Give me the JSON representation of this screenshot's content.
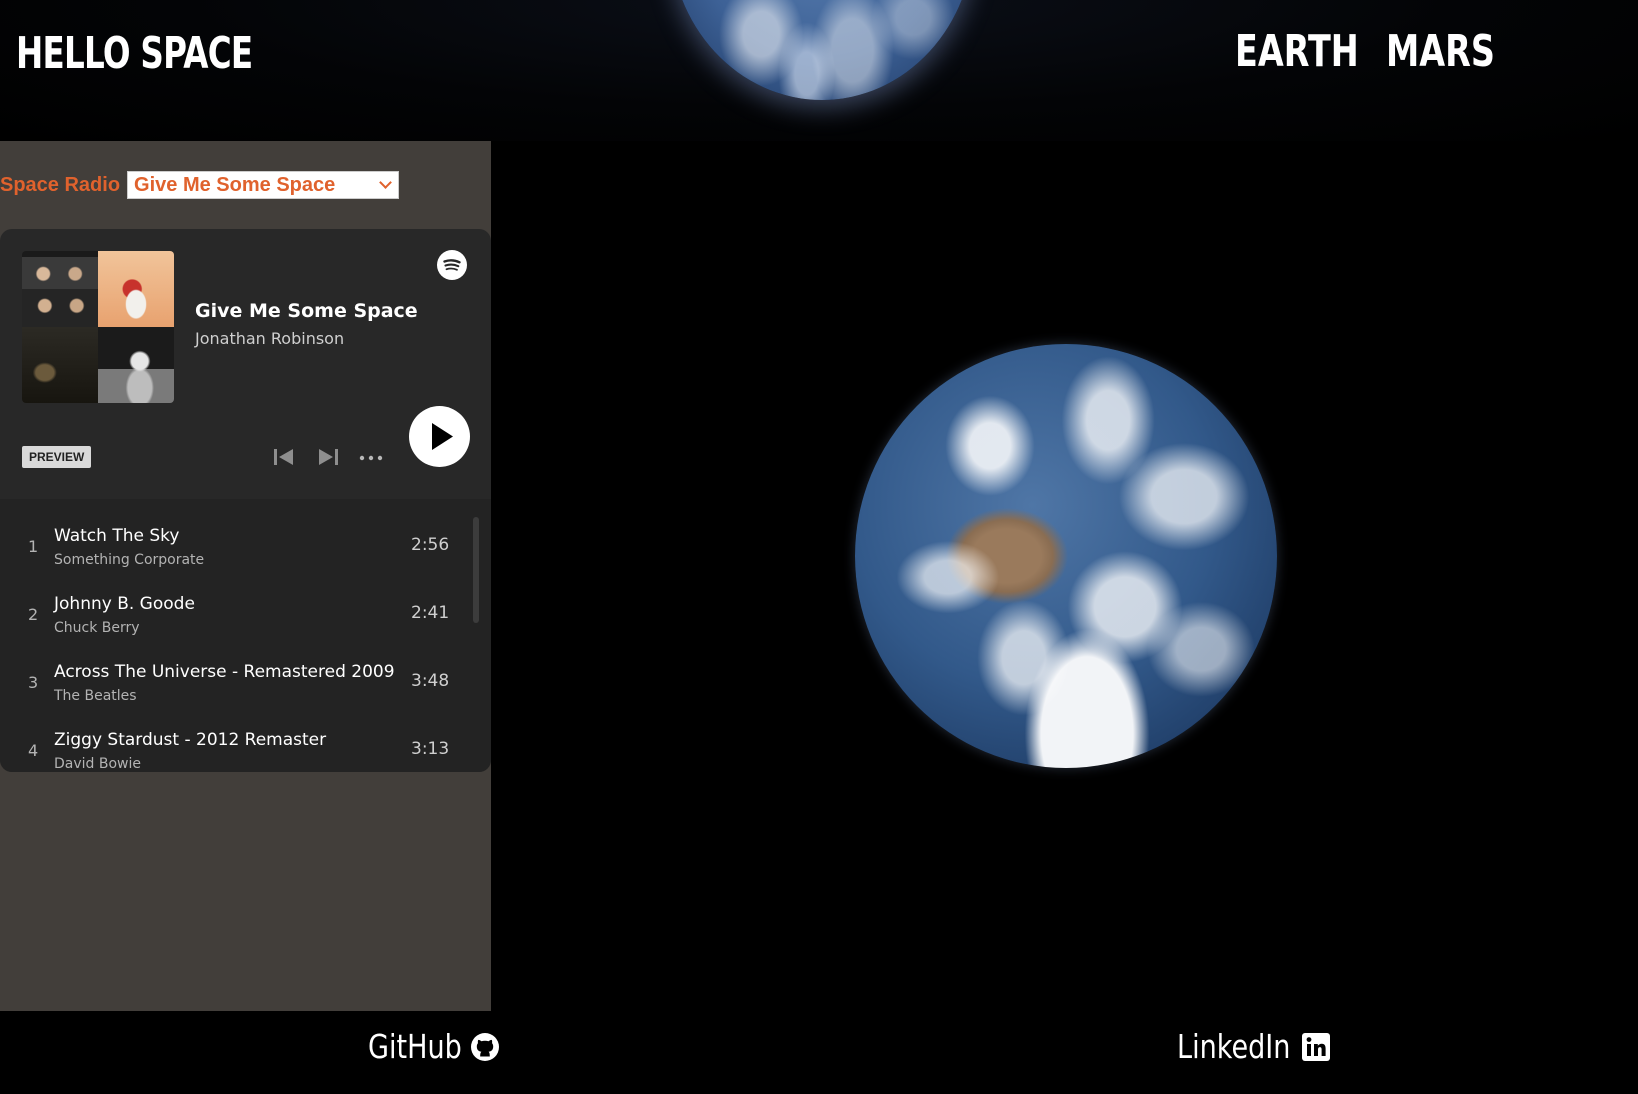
{
  "header": {
    "brand": "HELLO SPACE",
    "nav": {
      "earth": "EARTH",
      "mars": "MARS"
    }
  },
  "radio": {
    "label": "Space Radio",
    "selected": "Give Me Some Space"
  },
  "player": {
    "title": "Give Me Some Space",
    "artist": "Jonathan Robinson",
    "preview_badge": "PREVIEW",
    "icons": {
      "logo": "spotify-icon",
      "prev": "skip-back-icon",
      "next": "skip-forward-icon",
      "more": "more-icon",
      "play": "play-icon"
    },
    "tracks": [
      {
        "num": "1",
        "title": "Watch The Sky",
        "artist": "Something Corporate",
        "duration": "2:56"
      },
      {
        "num": "2",
        "title": "Johnny B. Goode",
        "artist": "Chuck Berry",
        "duration": "2:41"
      },
      {
        "num": "3",
        "title": "Across The Universe - Remastered 2009",
        "artist": "The Beatles",
        "duration": "3:48"
      },
      {
        "num": "4",
        "title": "Ziggy Stardust - 2012 Remaster",
        "artist": "David Bowie",
        "duration": "3:13"
      }
    ]
  },
  "footer": {
    "github": "GitHub",
    "linkedin": "LinkedIn"
  },
  "colors": {
    "accent": "#e0622d",
    "panel": "#423e3a",
    "player": "#282828",
    "background": "#000000"
  }
}
